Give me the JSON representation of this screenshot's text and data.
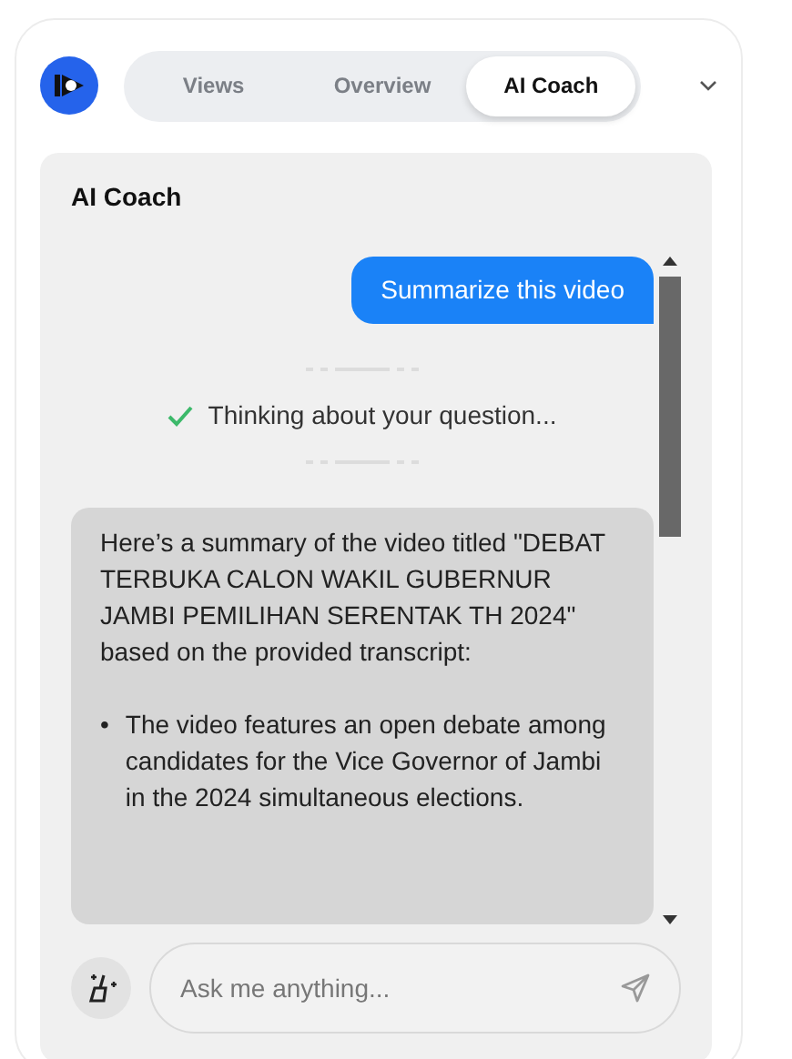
{
  "tabs": [
    {
      "label": "Views",
      "selected": false
    },
    {
      "label": "Overview",
      "selected": false
    },
    {
      "label": "AI Coach",
      "selected": true
    }
  ],
  "panel": {
    "title": "AI Coach"
  },
  "messages": [
    {
      "kind": "user",
      "text": "Summarize this video"
    },
    {
      "kind": "status",
      "text": "Thinking about your question...",
      "done": true
    },
    {
      "kind": "assistant",
      "text": "Here’s a summary of the video titled \"DEBAT TERBUKA CALON WAKIL GUBERNUR JAMBI PEMILIHAN SERENTAK TH 2024\" based on the provided transcript:",
      "bullets": [
        {
          "marker": "•",
          "text": "The video features an open debate among candidates for the Vice Governor of Jambi in the 2024 simultaneous elections."
        }
      ]
    }
  ],
  "composer": {
    "placeholder": "Ask me anything..."
  }
}
